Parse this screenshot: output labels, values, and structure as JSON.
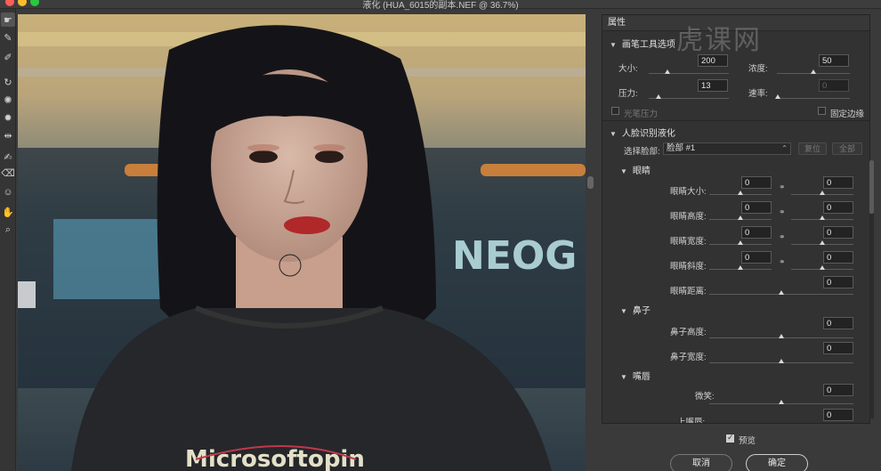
{
  "window": {
    "title": "液化 (HUA_6015的副本.NEF @ 36.7%)"
  },
  "watermark": "虎课网",
  "toolbar": {
    "tools": [
      {
        "icon": "forward-warp-icon",
        "glyph": "☛"
      },
      {
        "icon": "reconstruct-icon",
        "glyph": "✎"
      },
      {
        "icon": "smooth-icon",
        "glyph": "✐"
      },
      {
        "icon": "twirl-icon",
        "glyph": "↻"
      },
      {
        "icon": "pucker-icon",
        "glyph": "✺"
      },
      {
        "icon": "bloat-icon",
        "glyph": "✹"
      },
      {
        "icon": "push-left-icon",
        "glyph": "⇹"
      },
      {
        "icon": "freeze-mask-icon",
        "glyph": "✍"
      },
      {
        "icon": "thaw-mask-icon",
        "glyph": "⌫"
      },
      {
        "icon": "face-tool-icon",
        "glyph": "☺"
      },
      {
        "icon": "hand-icon",
        "glyph": "✋"
      },
      {
        "icon": "zoom-icon",
        "glyph": "⌕"
      }
    ]
  },
  "canvas": {
    "shirt_text": "Microsoftopin",
    "sign_text": "NEOG"
  },
  "panel": {
    "header": "属性",
    "brush_section": {
      "title": "画笔工具选项",
      "size_label": "大小:",
      "size_value": "200",
      "density_label": "浓度:",
      "density_value": "50",
      "pressure_label": "压力:",
      "pressure_value": "13",
      "rate_label": "速率:",
      "rate_value": "0",
      "stylus_label": "光笔压力",
      "pin_edges_label": "固定边缘",
      "size_frac": 0.25,
      "density_frac": 0.5,
      "pressure_frac": 0.13,
      "rate_frac": 0.0
    },
    "face_section": {
      "title": "人脸识别液化",
      "select_face_label": "选择脸部:",
      "select_face_value": "脸部 #1",
      "reset_label": "复位",
      "all_label": "全部",
      "eyes_title": "眼睛",
      "eye_size_label": "眼睛大小:",
      "eye_height_label": "眼睛高度:",
      "eye_width_label": "眼睛宽度:",
      "eye_tilt_label": "眼睛斜度:",
      "eye_distance_label": "眼睛距离:",
      "nose_title": "鼻子",
      "nose_height_label": "鼻子高度:",
      "nose_width_label": "鼻子宽度:",
      "mouth_title": "嘴唇",
      "smile_label": "微笑:",
      "upper_lip_label": "上嘴唇:",
      "zero": "0"
    }
  },
  "footer": {
    "preview_label": "预览",
    "cancel_label": "取消",
    "ok_label": "确定"
  }
}
